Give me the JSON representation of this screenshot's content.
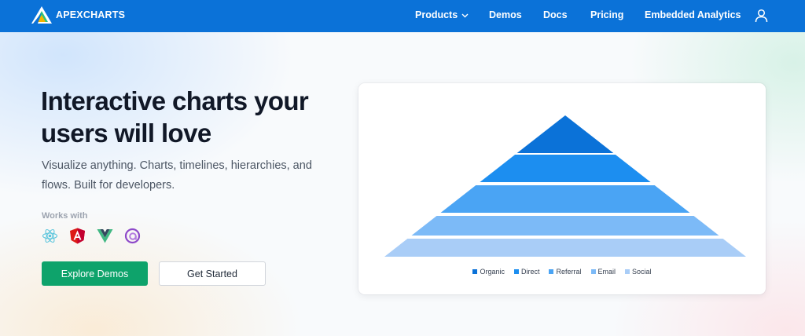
{
  "nav": {
    "brand": "APEXCHARTS",
    "items": [
      {
        "label": "Products",
        "has_dropdown": true
      },
      {
        "label": "Demos"
      },
      {
        "label": "Docs"
      },
      {
        "label": "Pricing"
      },
      {
        "label": "Embedded Analytics"
      }
    ],
    "user_icon": "user-icon",
    "colors": {
      "bar": "#0b72d8"
    }
  },
  "hero": {
    "headline_line1": "Interactive charts your",
    "headline_line2": "users will love",
    "subtext_line1": "Visualize anything. Charts, timelines, hierarchies, and",
    "subtext_line2": "flows. Built for developers.",
    "works_with": "Works with",
    "frameworks": [
      "react-icon",
      "angular-icon",
      "vue-icon",
      "blazor-icon"
    ],
    "primary_button": "Explore Demos",
    "secondary_button": "Get Started",
    "colors": {
      "primary": "#0ea36b"
    }
  },
  "chart_data": {
    "type": "pyramid",
    "title": "",
    "categories": [
      "Organic",
      "Direct",
      "Referral",
      "Email",
      "Social"
    ],
    "colors": [
      "#0b72d8",
      "#1c8ef0",
      "#4aa4f4",
      "#7cbaf7",
      "#a9cdf7"
    ],
    "legend_position": "bottom"
  }
}
